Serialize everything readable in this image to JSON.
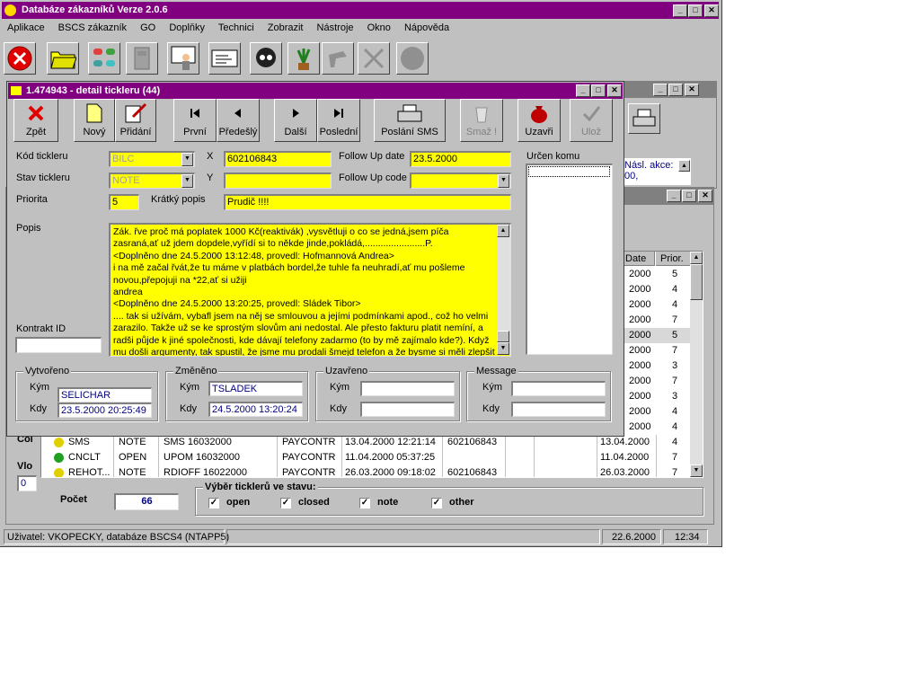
{
  "app": {
    "title": "Databáze zákazníků   Verze 2.0.6"
  },
  "menu": [
    "Aplikace",
    "BSCS zákazník",
    "GO",
    "Doplňky",
    "Technici",
    "Zobrazit",
    "Nástroje",
    "Okno",
    "Nápověda"
  ],
  "detail": {
    "title": "1.474943 - detail tickleru (44)",
    "buttons": {
      "back": "Zpět",
      "new": "Nový",
      "add": "Přidání",
      "first": "První",
      "prev": "Předešlý",
      "next": "Další",
      "last": "Poslední",
      "sms": "Poslání SMS",
      "delete": "Smaž !",
      "close": "Uzavři",
      "save": "Ulož"
    },
    "labels": {
      "kod": "Kód tickleru",
      "stav": "Stav tickleru",
      "priorita": "Priorita",
      "kratky": "Krátký popis",
      "popis": "Popis",
      "kontrakt": "Kontrakt ID",
      "x": "X",
      "y": "Y",
      "fudate": "Follow Up date",
      "fucode": "Follow Up code",
      "urcen": "Určen komu"
    },
    "values": {
      "kod": "BILC",
      "stav": "NOTE",
      "priorita": "5",
      "x": "602106843",
      "y": "",
      "fudate": "23.5.2000",
      "fucode": "",
      "kratky": "Prudič !!!!",
      "kontrakt": ""
    },
    "popis_lines": [
      "Zák. řve proč má poplatek 1000 Kč(reaktivák) ,vysvětluji o co se jedná,jsem píča",
      "zasraná,ať už jdem dopdele,vyřídí si to někde jinde,pokládá,.......................P.",
      "<Doplněno dne 24.5.2000 13:12:48, provedl: Hofmannová Andrea>",
      "i na mě začal řvát,že tu máme v platbách bordel,že tuhle fa neuhradí,ať mu pošleme",
      "novou,přepojuji na *22,ať si užiji",
      "andrea",
      "<Doplněno dne 24.5.2000 13:20:25, provedl: Sládek Tibor>",
      ".... tak si užívám, vybafl jsem na něj se smlouvou a jejími podmínkami apod., což ho velmi",
      "zarazilo. Takže už se ke sprostým slovům ani nedostal. Ale přesto fakturu platit nemíní, a",
      "radši půjde k jiné společnosti, kde dávají telefony zadarmo (to by mě zajímalo kde?). Když",
      "mu došli argumenty, tak spustil, že jsme mu prodali šmejd telefon a že bysme si měli zlepšit"
    ],
    "groups": {
      "vytvoreno": {
        "title": "Vytvořeno",
        "kym_label": "Kým",
        "kdy_label": "Kdy",
        "kym": "SELICHAR",
        "kdy": "23.5.2000 20:25:49"
      },
      "zmeneno": {
        "title": "Změněno",
        "kym_label": "Kým",
        "kdy_label": "Kdy",
        "kym": "TSLADEK",
        "kdy": "24.5.2000 13:20:24"
      },
      "uzavreno": {
        "title": "Uzavřeno",
        "kym_label": "Kým",
        "kdy_label": "Kdy",
        "kym": "",
        "kdy": ""
      },
      "message": {
        "title": "Message",
        "kym_label": "Kým",
        "kdy_label": "Kdy",
        "kym": "",
        "kdy": ""
      }
    }
  },
  "bg_window": {
    "nasl_akce": "Násl. akce:",
    "nasl_val": "00,"
  },
  "list": {
    "headers": {
      "date": "Date",
      "prior": "Prior."
    },
    "right_rows": [
      {
        "date": "2000",
        "prior": "5"
      },
      {
        "date": "2000",
        "prior": "4"
      },
      {
        "date": "2000",
        "prior": "4"
      },
      {
        "date": "2000",
        "prior": "7"
      },
      {
        "date": "2000",
        "prior": "5"
      },
      {
        "date": "2000",
        "prior": "7"
      },
      {
        "date": "2000",
        "prior": "3"
      },
      {
        "date": "2000",
        "prior": "7"
      },
      {
        "date": "2000",
        "prior": "3"
      },
      {
        "date": "2000",
        "prior": "4"
      },
      {
        "date": "2000",
        "prior": "4"
      }
    ],
    "rows": [
      {
        "code": "SMS",
        "stav": "NOTE",
        "desc": "SMS 16032000",
        "user": "PAYCONTR",
        "created": "13.04.2000 12:21:14",
        "x": "602106843",
        "date": "13.04.2000",
        "prior": "4"
      },
      {
        "code": "CNCLT",
        "stav": "OPEN",
        "desc": "UPOM 16032000",
        "user": "PAYCONTR",
        "created": "11.04.2000 05:37:25",
        "x": "",
        "date": "11.04.2000",
        "prior": "7"
      },
      {
        "code": "REHOT...",
        "stav": "NOTE",
        "desc": "RDIOFF 16022000",
        "user": "PAYCONTR",
        "created": "26.03.2000 09:18:02",
        "x": "602106843",
        "date": "26.03.2000",
        "prior": "7"
      }
    ],
    "side_labels": {
      "col": "Col",
      "vlo": "Vlo",
      "zero": "0"
    },
    "pocet_label": "Počet",
    "pocet": "66",
    "filter": {
      "title": "Výběr ticklerů ve stavu:",
      "open": "open",
      "closed": "closed",
      "note": "note",
      "other": "other"
    }
  },
  "status": {
    "user": "Uživatel: VKOPECKY, databáze BSCS4 (NTAPP5)",
    "date": "22.6.2000",
    "time": "12:34"
  }
}
